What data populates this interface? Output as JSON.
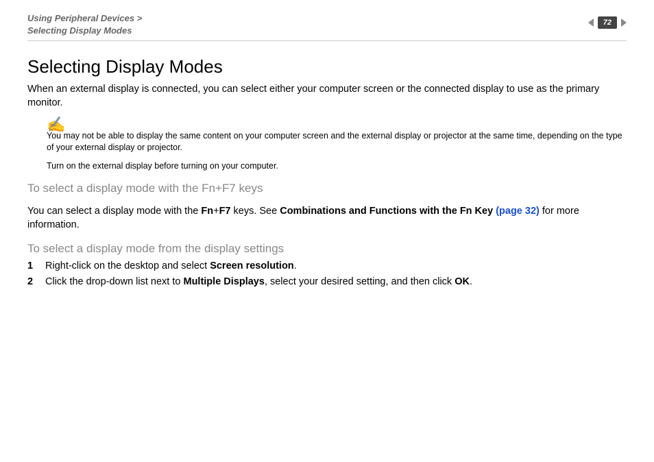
{
  "header": {
    "breadcrumb_line1": "Using Peripheral Devices >",
    "breadcrumb_line2": "Selecting Display Modes",
    "page_number": "72"
  },
  "title": "Selecting Display Modes",
  "intro": "When an external display is connected, you can select either your computer screen or the connected display to use as the primary monitor.",
  "note_icon": "✍",
  "note1": "You may not be able to display the same content on your computer screen and the external display or projector at the same time, depending on the type of your external display or projector.",
  "note2": "Turn on the external display before turning on your computer.",
  "section1": {
    "heading": "To select a display mode with the Fn+F7 keys",
    "p_pre": "You can select a display mode with the ",
    "p_fn": "Fn",
    "p_plus": "+",
    "p_f7": "F7",
    "p_mid": " keys. See ",
    "p_linklabel": "Combinations and Functions with the Fn Key ",
    "p_linkpage": "(page 32)",
    "p_post": " for more information."
  },
  "section2": {
    "heading": "To select a display mode from the display settings",
    "step1_pre": "Right-click on the desktop and select ",
    "step1_bold": "Screen resolution",
    "step1_post": ".",
    "step2_pre": "Click the drop-down list next to ",
    "step2_bold1": "Multiple Displays",
    "step2_mid": ", select your desired setting, and then click ",
    "step2_bold2": "OK",
    "step2_post": "."
  }
}
